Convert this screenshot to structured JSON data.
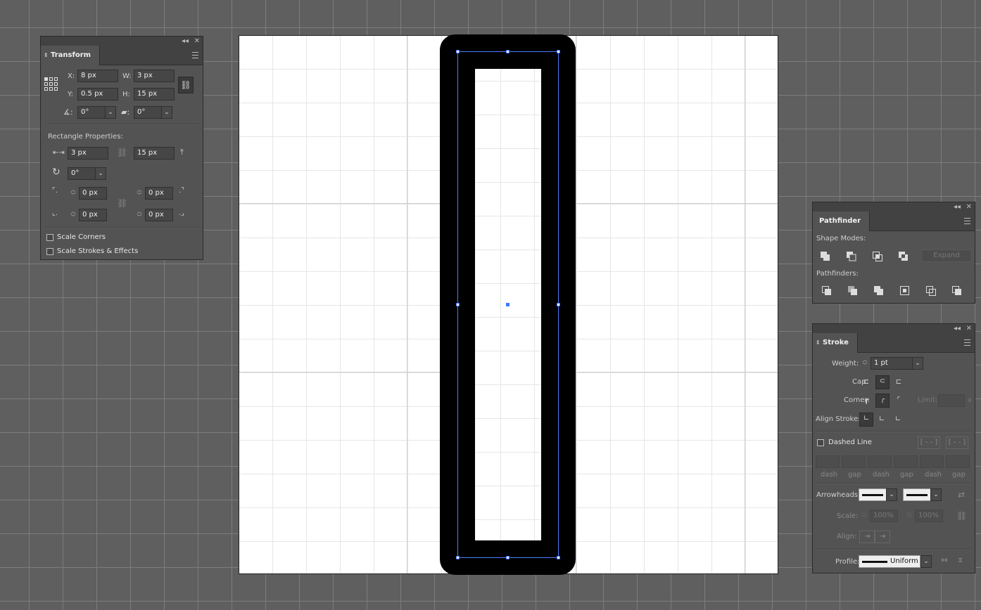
{
  "panel_controls": {
    "collapse": "◂◂",
    "close": "✕"
  },
  "transform": {
    "tab": "Transform",
    "x_label": "X:",
    "x_value": "8 px",
    "y_label": "Y:",
    "y_value": "0.5 px",
    "w_label": "W:",
    "w_value": "3 px",
    "h_label": "H:",
    "h_value": "15 px",
    "angle_value": "0°",
    "shear_value": "0°",
    "rect_props_label": "Rectangle Properties:",
    "rect_width": "3 px",
    "rect_height": "15 px",
    "rect_rotation": "0°",
    "corner_tl": "0 px",
    "corner_tr": "0 px",
    "corner_bl": "0 px",
    "corner_br": "0 px",
    "scale_corners": "Scale Corners",
    "scale_strokes": "Scale Strokes & Effects",
    "scale_corners_checked": false,
    "scale_strokes_checked": false
  },
  "pathfinder": {
    "tab": "Pathfinder",
    "shape_modes_label": "Shape Modes:",
    "expand_label": "Expand",
    "pathfinders_label": "Pathfinders:"
  },
  "stroke": {
    "tab": "Stroke",
    "weight_label": "Weight:",
    "weight_value": "1 pt",
    "cap_label": "Cap:",
    "corner_label": "Corner:",
    "limit_label": "Limit:",
    "limit_suffix": "x",
    "align_label": "Align Stroke:",
    "dashed_label": "Dashed Line",
    "dashed_checked": false,
    "dash_labels": [
      "dash",
      "gap",
      "dash",
      "gap",
      "dash",
      "gap"
    ],
    "arrowheads_label": "Arrowheads:",
    "scale_label": "Scale:",
    "scale_start": "100%",
    "scale_end": "100%",
    "align_arrow_label": "Align:",
    "profile_label": "Profile:",
    "profile_value": "Uniform"
  },
  "colors": {
    "selection": "#4a7cff",
    "panel": "#535353",
    "canvas": "#5f5f5f"
  }
}
